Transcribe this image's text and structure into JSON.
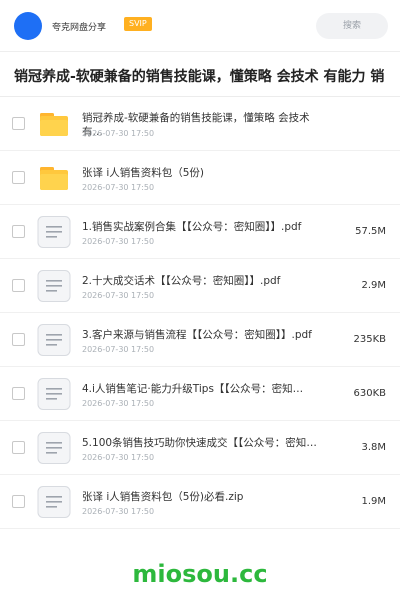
{
  "header": {
    "share_name": "夸克网盘分享",
    "vip_badge": "SVIP",
    "search_label": "搜索"
  },
  "folder_title": "销冠养成-软硬兼备的销售技能课，懂策略 会技术 有能力 销",
  "files": [
    {
      "type": "folder",
      "name": "销冠养成-软硬兼备的销售技能课，懂策略 会技术 有…",
      "date": "2026-07-30 17:50",
      "size": ""
    },
    {
      "type": "folder",
      "name": "张译 i人销售资料包（5份)",
      "date": "2026-07-30 17:50",
      "size": ""
    },
    {
      "type": "file",
      "name": "1.销售实战案例合集【【公众号：密知圈】】.pdf",
      "date": "2026-07-30 17:50",
      "size": "57.5M"
    },
    {
      "type": "file",
      "name": "2.十大成交话术【【公众号：密知圈】】.pdf",
      "date": "2026-07-30 17:50",
      "size": "2.9M"
    },
    {
      "type": "file",
      "name": "3.客户来源与销售流程【【公众号：密知圈】】.pdf",
      "date": "2026-07-30 17:50",
      "size": "235KB"
    },
    {
      "type": "file",
      "name": "4.i人销售笔记·能力升级Tips【【公众号：密知…",
      "date": "2026-07-30 17:50",
      "size": "630KB"
    },
    {
      "type": "file",
      "name": "5.100条销售技巧助你快速成交【【公众号：密知圈…",
      "date": "2026-07-30 17:50",
      "size": "3.8M"
    },
    {
      "type": "file",
      "name": "张译 i人销售资料包（5份)必看.zip",
      "date": "2026-07-30 17:50",
      "size": "1.9M"
    }
  ],
  "watermark": "miosou.cc",
  "colors": {
    "accent": "#1e6ff5",
    "vip": "#ffb020",
    "folder": "#ffc83d",
    "watermark": "#2db83d"
  }
}
